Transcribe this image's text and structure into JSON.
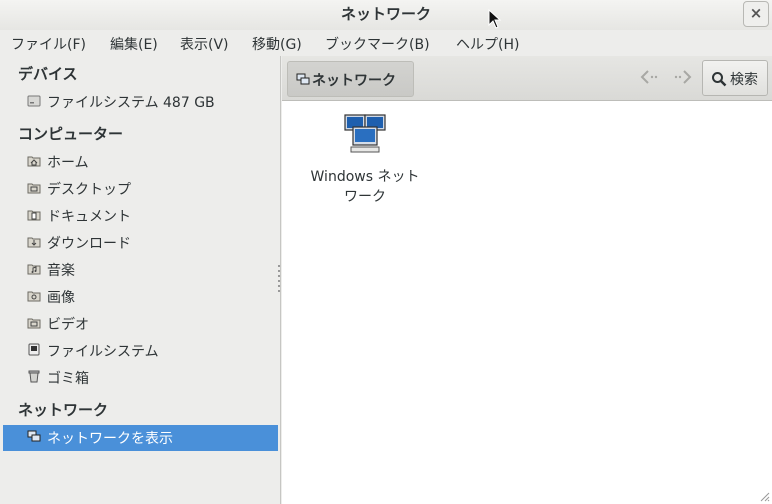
{
  "window": {
    "title": "ネットワーク",
    "close_label": "×"
  },
  "menubar": {
    "items": [
      "ファイル(F)",
      "編集(E)",
      "表示(V)",
      "移動(G)",
      "ブックマーク(B)",
      "ヘルプ(H)"
    ]
  },
  "sidebar": {
    "devices_heading": "デバイス",
    "devices": [
      {
        "label": "ファイルシステム 487 GB",
        "icon": "drive-icon"
      }
    ],
    "computer_heading": "コンピューター",
    "computer": [
      {
        "label": "ホーム",
        "icon": "home-folder-icon"
      },
      {
        "label": "デスクトップ",
        "icon": "desktop-folder-icon"
      },
      {
        "label": "ドキュメント",
        "icon": "documents-folder-icon"
      },
      {
        "label": "ダウンロード",
        "icon": "downloads-folder-icon"
      },
      {
        "label": "音楽",
        "icon": "music-folder-icon"
      },
      {
        "label": "画像",
        "icon": "pictures-folder-icon"
      },
      {
        "label": "ビデオ",
        "icon": "videos-folder-icon"
      },
      {
        "label": "ファイルシステム",
        "icon": "filesystem-icon"
      },
      {
        "label": "ゴミ箱",
        "icon": "trash-icon"
      }
    ],
    "network_heading": "ネットワーク",
    "network": [
      {
        "label": "ネットワークを表示",
        "icon": "network-icon",
        "selected": true
      }
    ]
  },
  "toolbar": {
    "path_label": "ネットワーク",
    "search_label": "検索"
  },
  "content": {
    "items": [
      {
        "name_line1": "Windows ネット",
        "name_line2": "ワーク",
        "icon": "windows-network-icon"
      }
    ]
  },
  "colors": {
    "selection": "#4a90d9",
    "background": "#ededeb",
    "content_bg": "#ffffff"
  }
}
